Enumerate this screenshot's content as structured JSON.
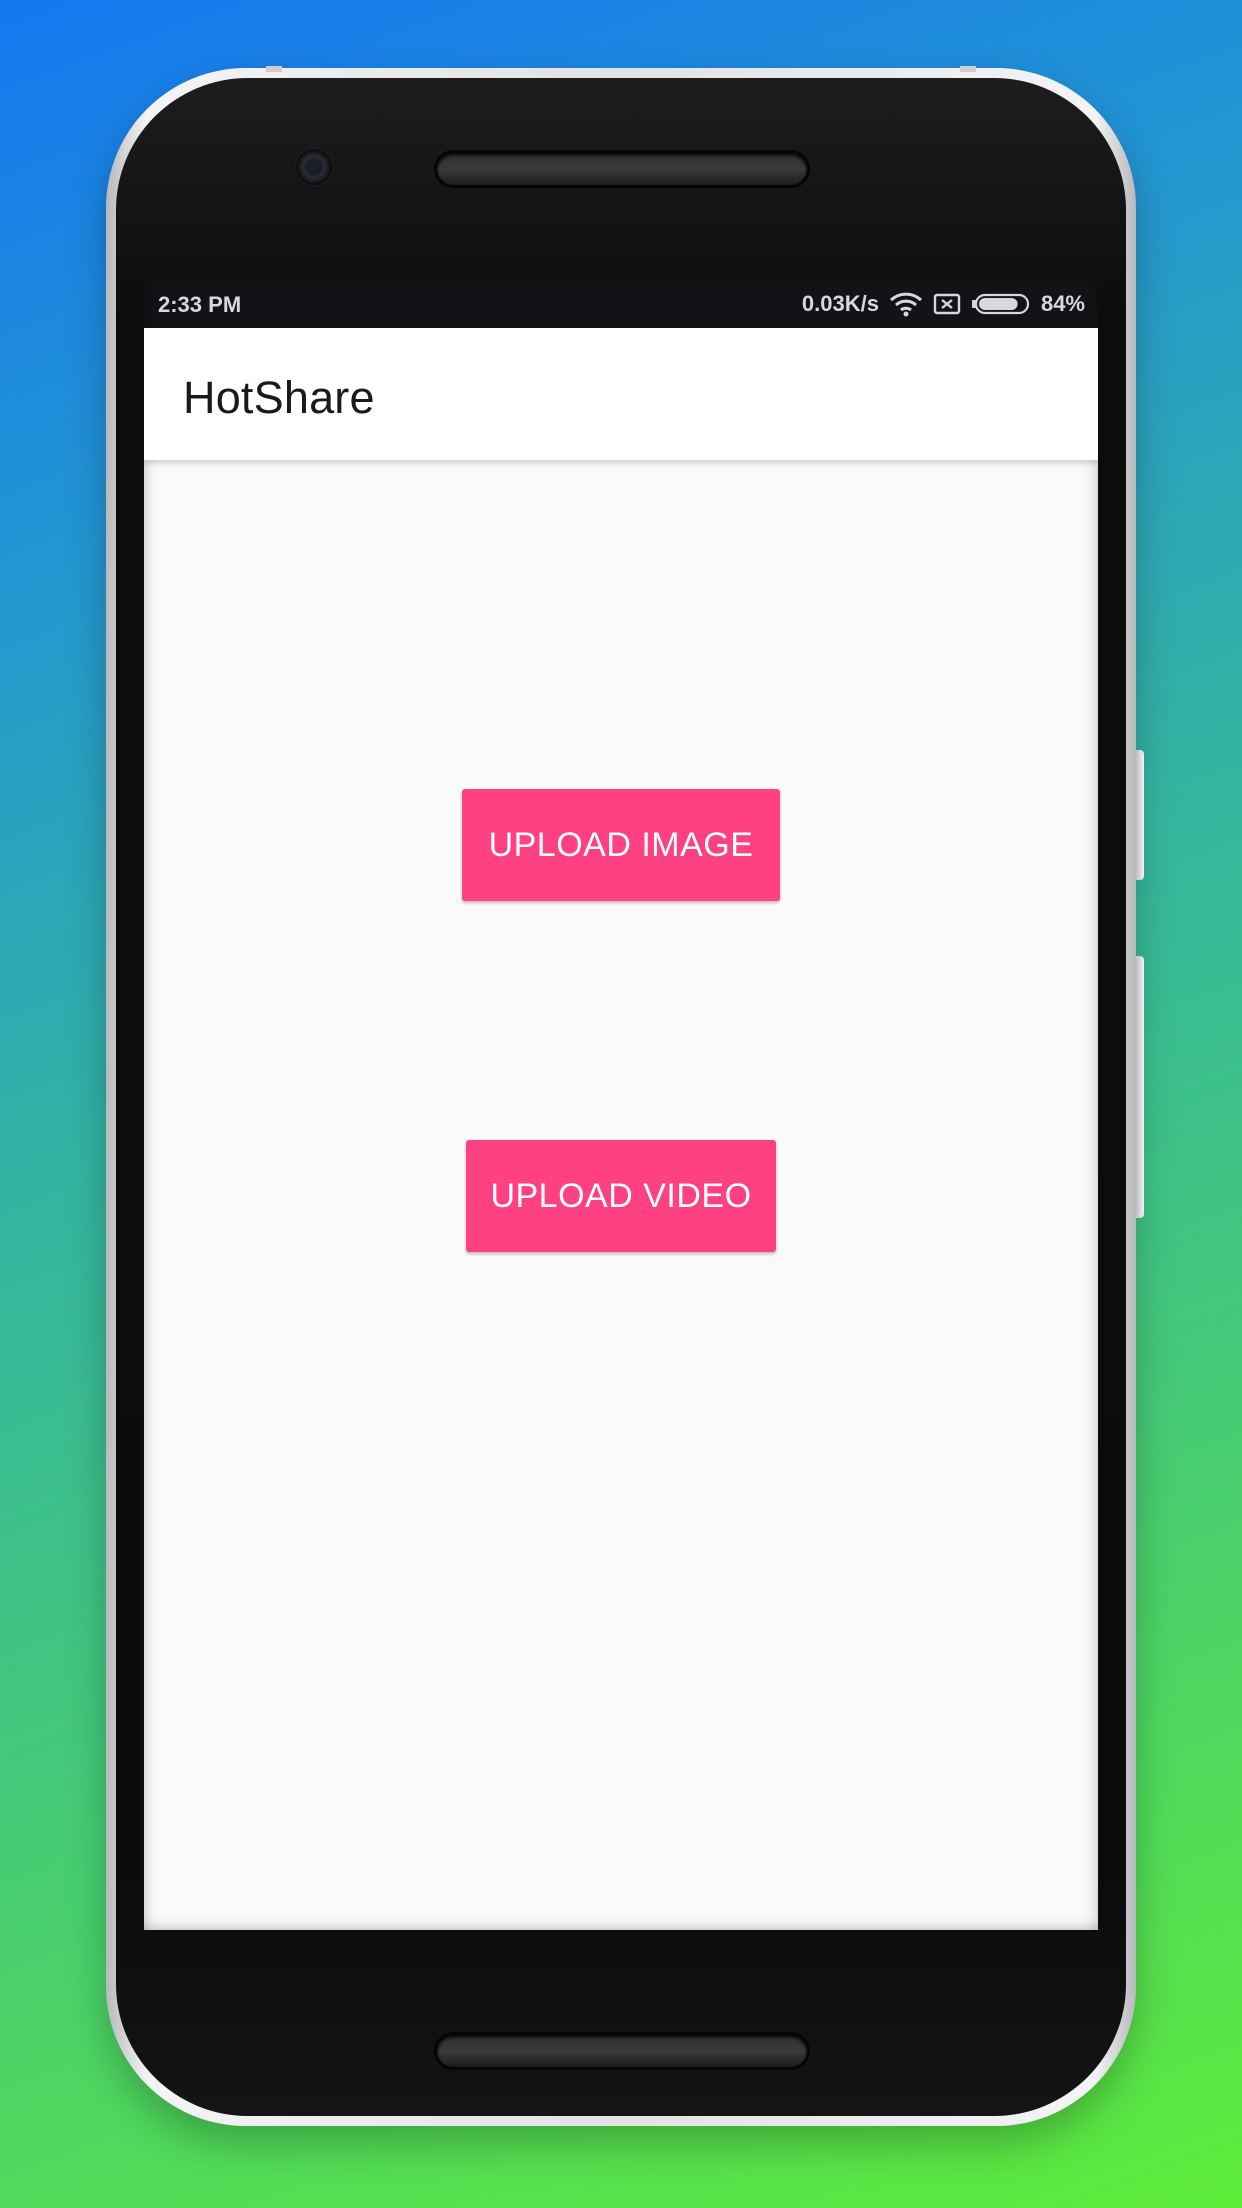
{
  "status_bar": {
    "time": "2:33 PM",
    "network_speed": "0.03K/s",
    "battery_percent": "84%",
    "battery_level": 0.84,
    "icons": [
      "wifi-icon",
      "no-sim-icon",
      "battery-icon"
    ]
  },
  "app_bar": {
    "title": "HotShare"
  },
  "main": {
    "upload_image_label": "UPLOAD IMAGE",
    "upload_video_label": "UPLOAD VIDEO"
  },
  "colors": {
    "accent": "#ff4081",
    "status_bar_bg": "#121317",
    "app_bar_bg": "#ffffff",
    "content_bg": "#fafafa"
  }
}
